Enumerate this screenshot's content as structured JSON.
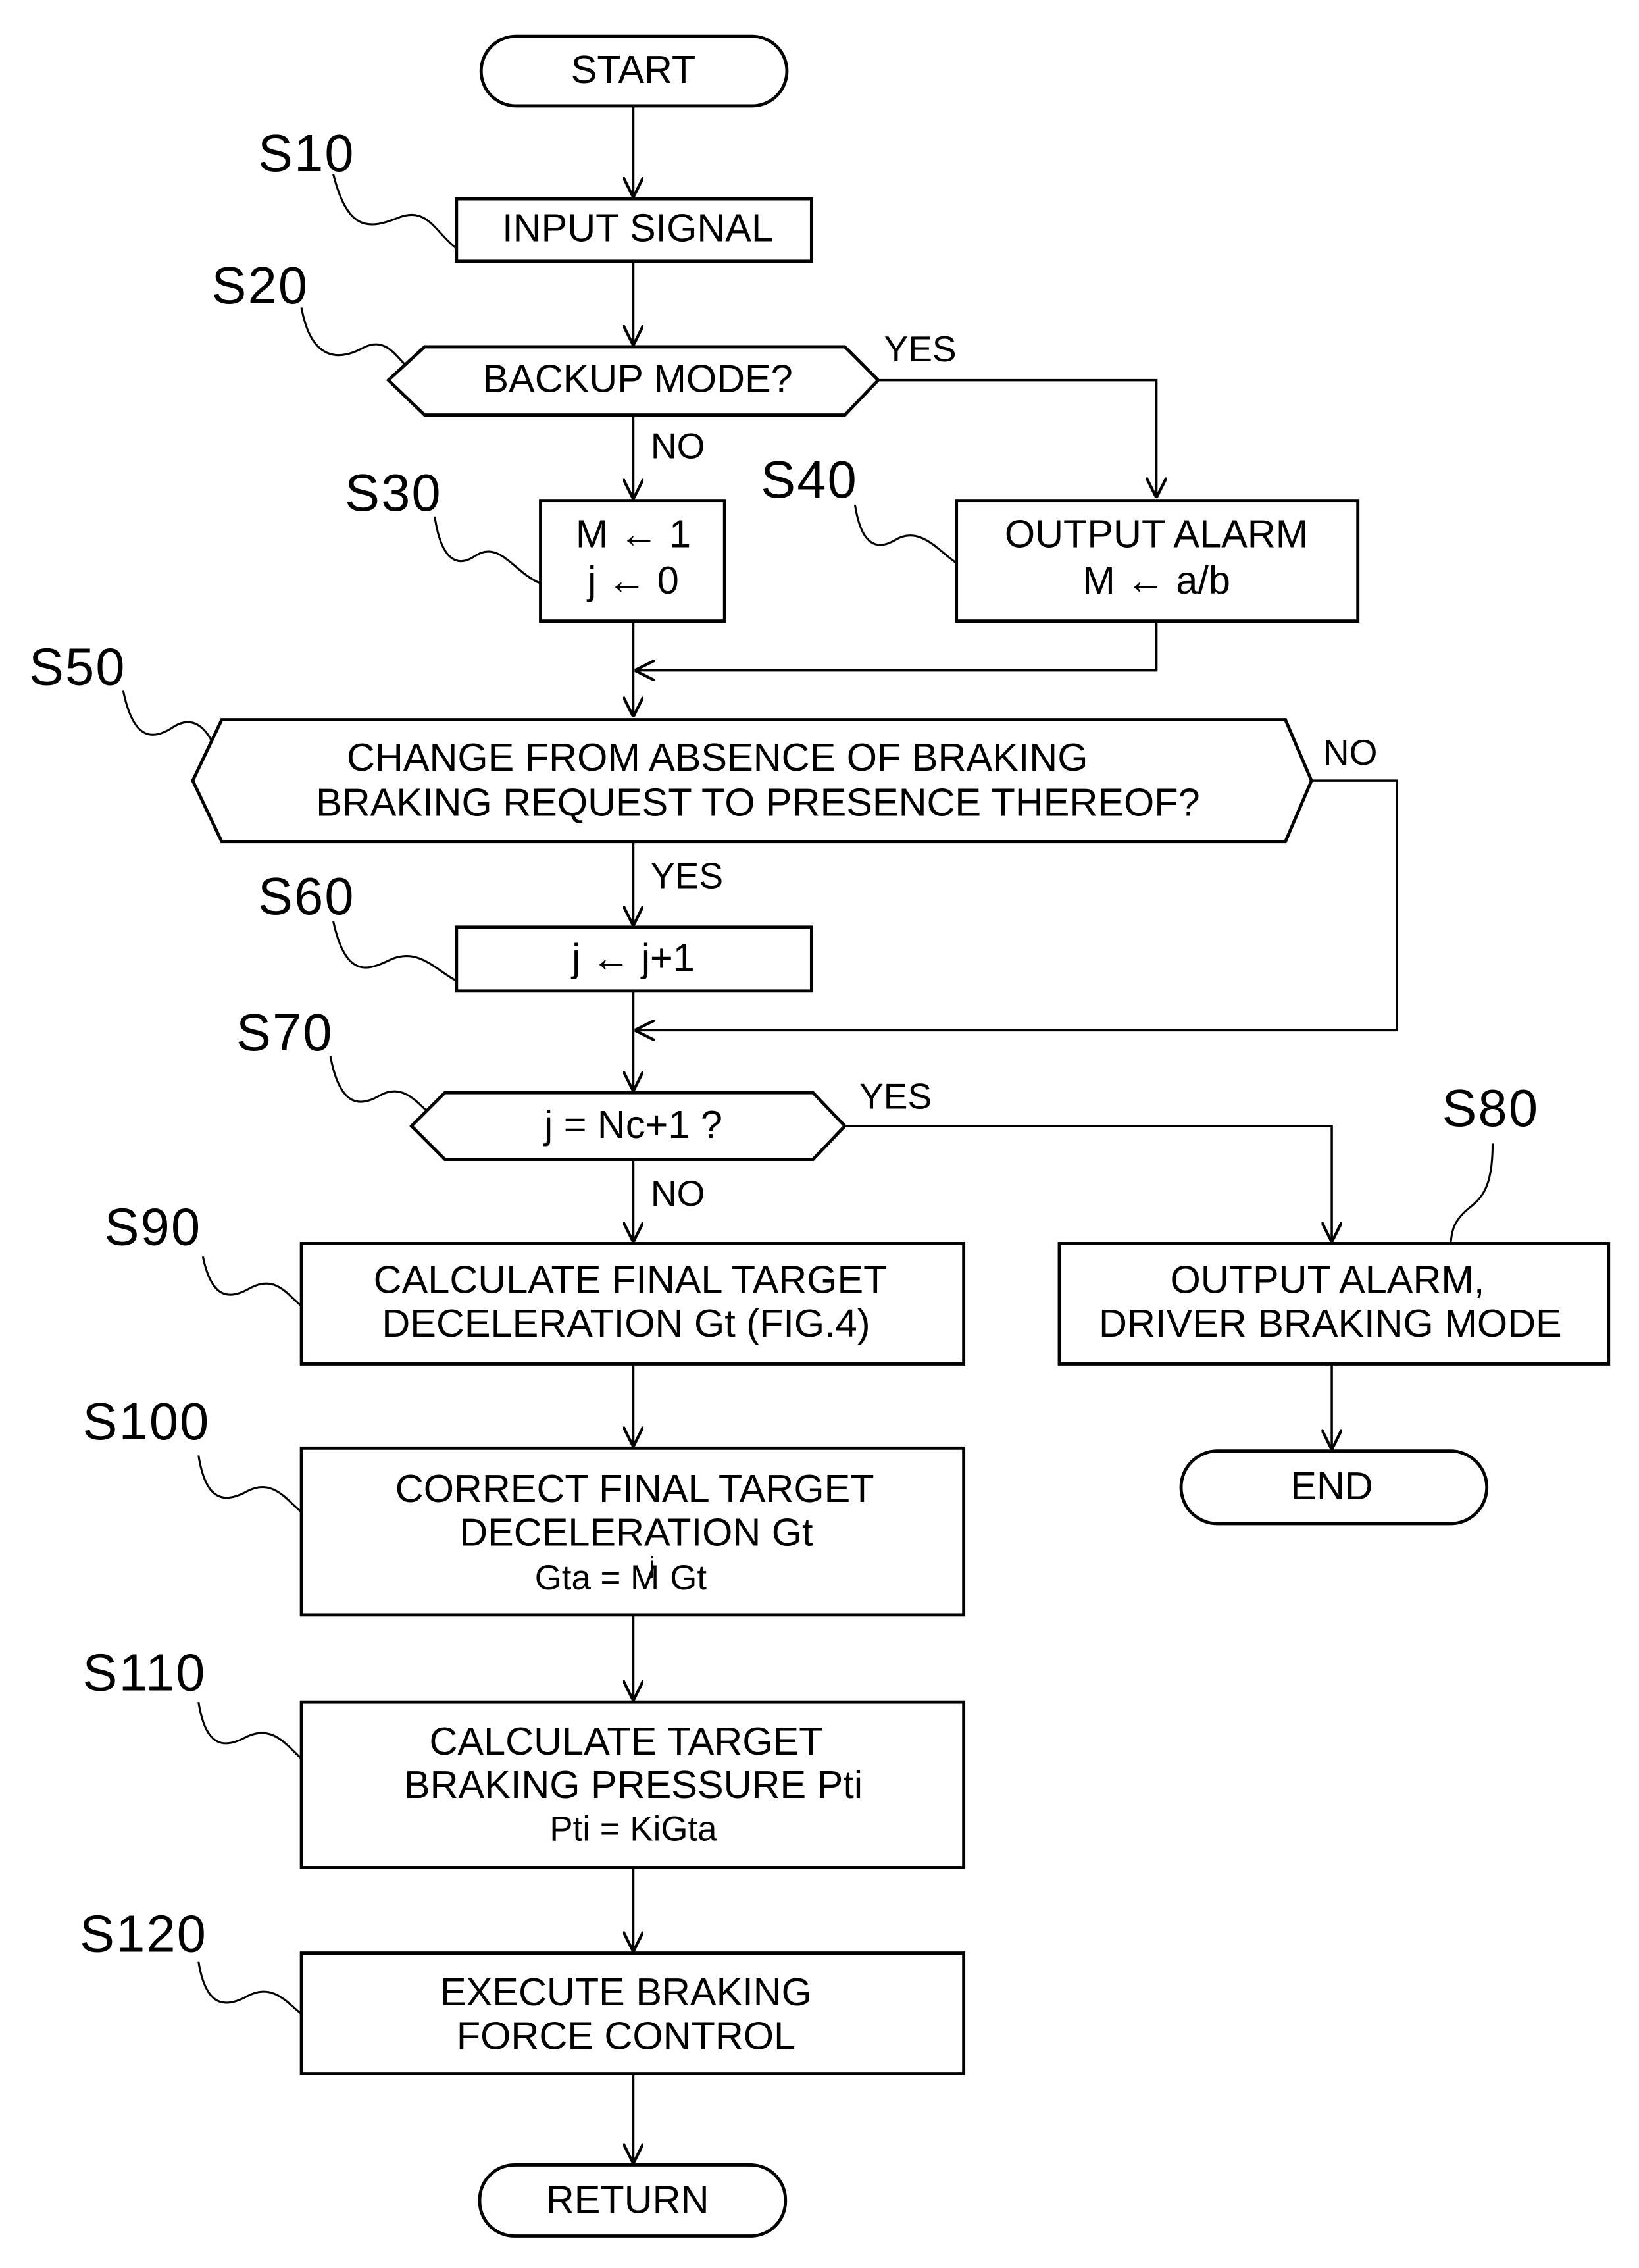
{
  "diagram": {
    "type": "flowchart",
    "terminals": {
      "start": "START",
      "end": "END",
      "return": "RETURN"
    },
    "steps": [
      {
        "id": "S10",
        "kind": "process",
        "lines": [
          "INPUT SIGNAL"
        ]
      },
      {
        "id": "S20",
        "kind": "decision",
        "lines": [
          "BACKUP MODE?"
        ],
        "yes": "S40",
        "no": "S30"
      },
      {
        "id": "S30",
        "kind": "process",
        "lines": [
          "M ← 1",
          "j ← 0"
        ]
      },
      {
        "id": "S40",
        "kind": "process",
        "lines": [
          "OUTPUT ALARM",
          "M ← a/b"
        ]
      },
      {
        "id": "S50",
        "kind": "decision",
        "lines": [
          "CHANGE FROM ABSENCE OF BRAKING",
          "BRAKING REQUEST TO PRESENCE THEREOF?"
        ],
        "yes": "S60",
        "no": "S70"
      },
      {
        "id": "S60",
        "kind": "process",
        "lines": [
          "j ← j+1"
        ]
      },
      {
        "id": "S70",
        "kind": "decision",
        "lines": [
          "j = Nc+1 ?"
        ],
        "yes": "S80",
        "no": "S90"
      },
      {
        "id": "S80",
        "kind": "process",
        "lines": [
          "OUTPUT ALARM,",
          "DRIVER BRAKING MODE"
        ]
      },
      {
        "id": "S90",
        "kind": "process",
        "lines": [
          "CALCULATE FINAL TARGET",
          "DECELERATION Gt (FIG.4)"
        ]
      },
      {
        "id": "S100",
        "kind": "process",
        "lines": [
          "CORRECT FINAL TARGET",
          "DECELERATION Gt",
          "Gta = M",
          "j",
          "Gt"
        ]
      },
      {
        "id": "S110",
        "kind": "process",
        "lines": [
          "CALCULATE TARGET",
          "BRAKING PRESSURE Pti",
          "Pti = KiGta"
        ]
      },
      {
        "id": "S120",
        "kind": "process",
        "lines": [
          "EXECUTE BRAKING",
          "FORCE CONTROL"
        ]
      }
    ],
    "branch_labels": {
      "yes": "YES",
      "no": "NO"
    }
  }
}
